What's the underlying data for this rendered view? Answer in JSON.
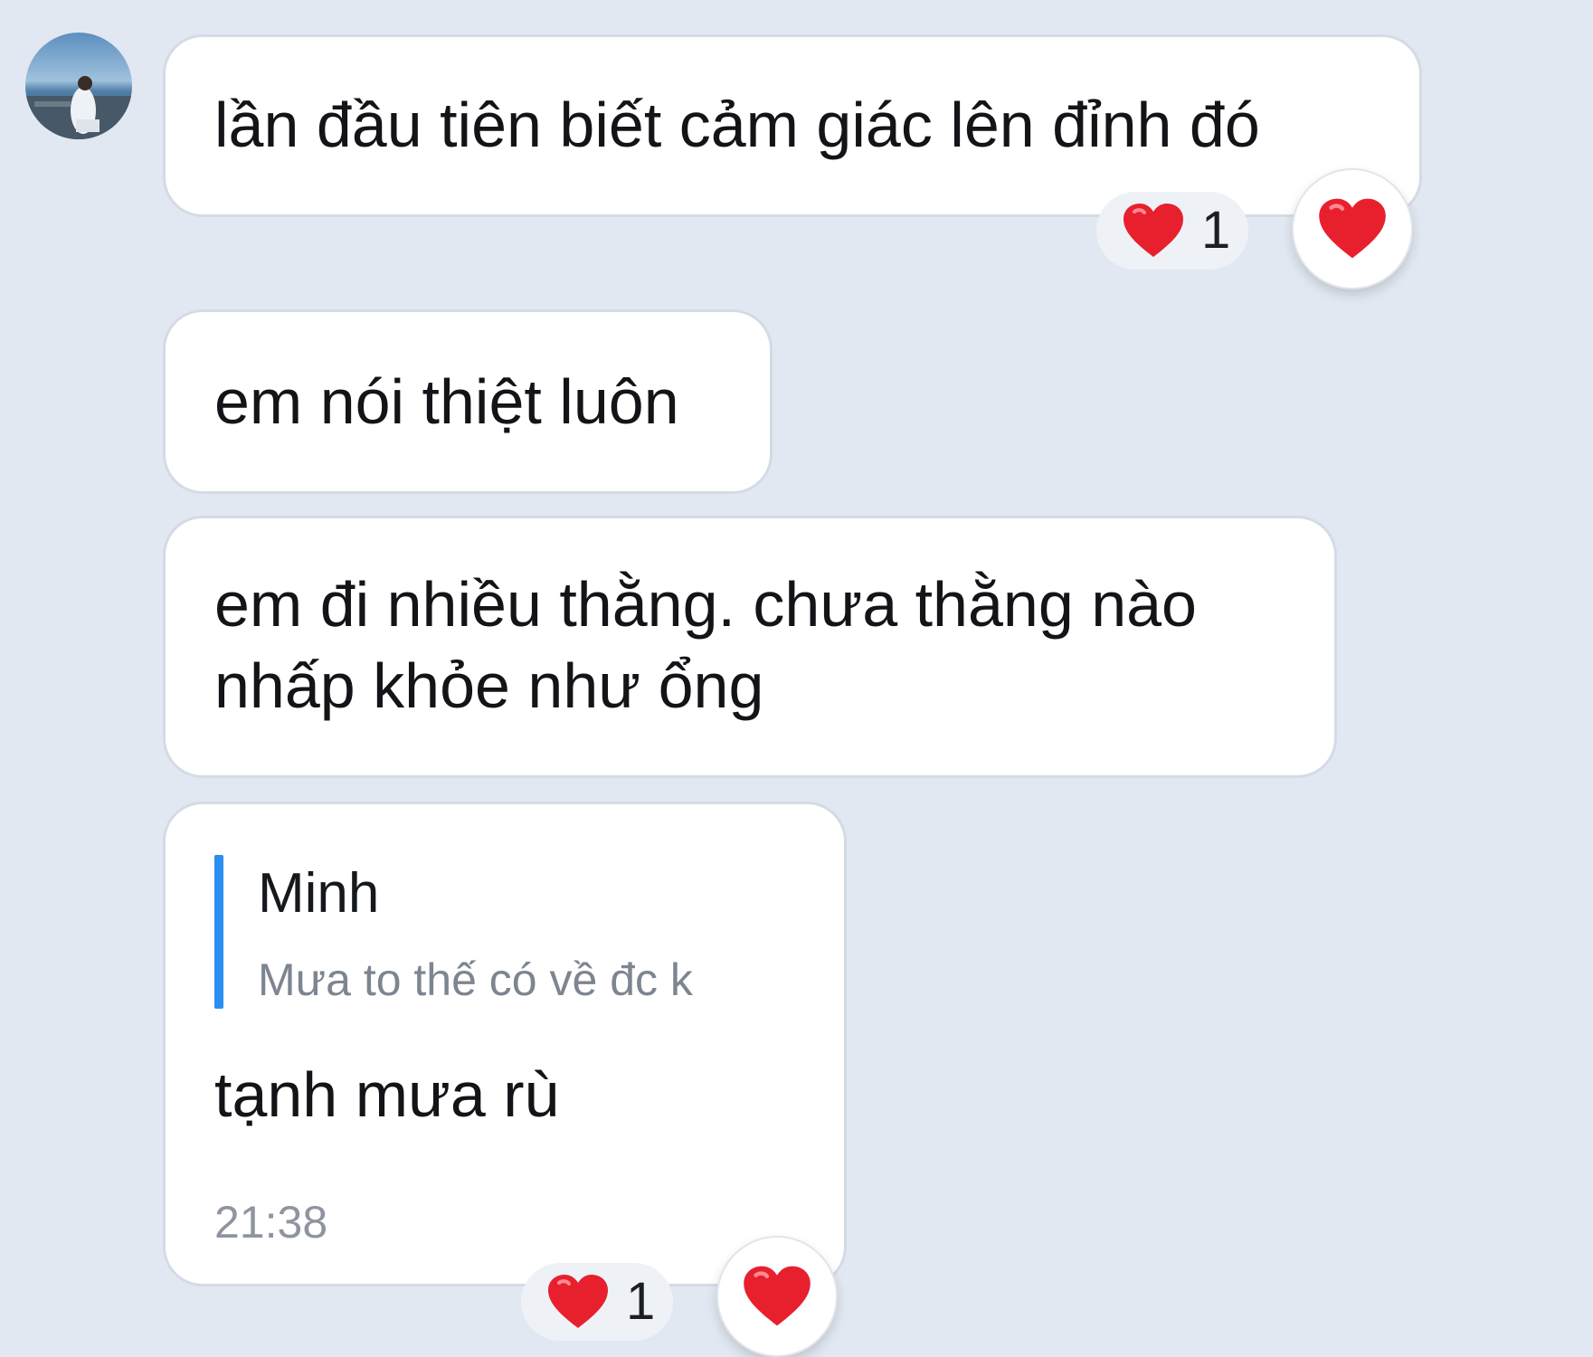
{
  "messages": [
    {
      "text": "lần đầu tiên biết cảm giác lên đỉnh đó",
      "reaction": {
        "icon": "heart-icon",
        "count": "1"
      }
    },
    {
      "text": "em nói thiệt luôn"
    },
    {
      "lines": [
        "em đi nhiều thằng. chưa thằng nào",
        "nhấp khỏe như ổng"
      ]
    },
    {
      "quote": {
        "name": "Minh",
        "text": "Mưa to thế có về đc k"
      },
      "text": "tạnh mưa rù",
      "time": "21:38",
      "reaction": {
        "icon": "heart-icon",
        "count": "1"
      }
    }
  ],
  "colors": {
    "background": "#e2e8f1",
    "bubble": "#ffffff",
    "quote_bar": "#2b8ff2",
    "heart": "#e8202e"
  }
}
